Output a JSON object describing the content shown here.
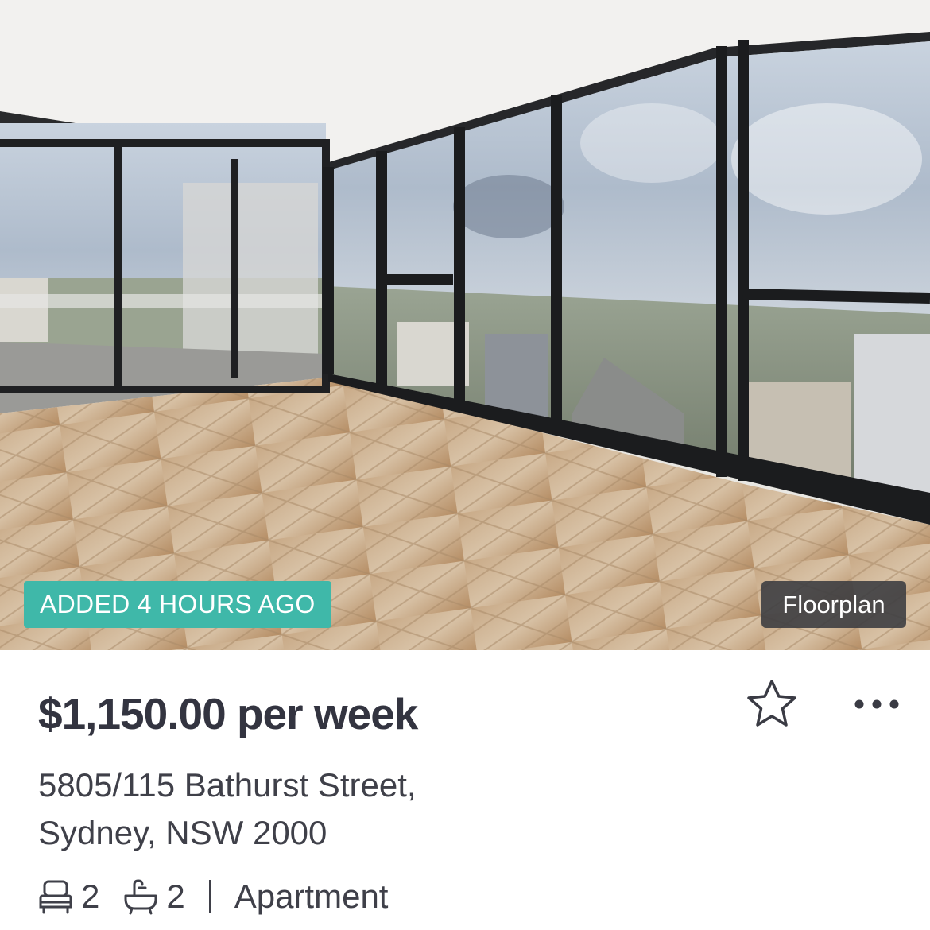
{
  "listing": {
    "added_badge": "ADDED 4 HOURS AGO",
    "floorplan_label": "Floorplan",
    "price": "$1,150.00 per week",
    "address_line1": "5805/115 Bathurst Street,",
    "address_line2": "Sydney, NSW 2000",
    "bedrooms": "2",
    "bathrooms": "2",
    "property_type": "Apartment"
  },
  "icons": {
    "bed": "bed-icon",
    "bath": "bath-icon",
    "favourite": "star-outline-icon",
    "more": "more-horizontal-icon"
  },
  "colors": {
    "badge_new": "#3fb8a9",
    "badge_floorplan": "#3a3b40",
    "text_primary": "#333440",
    "text_secondary": "#3f4049"
  }
}
